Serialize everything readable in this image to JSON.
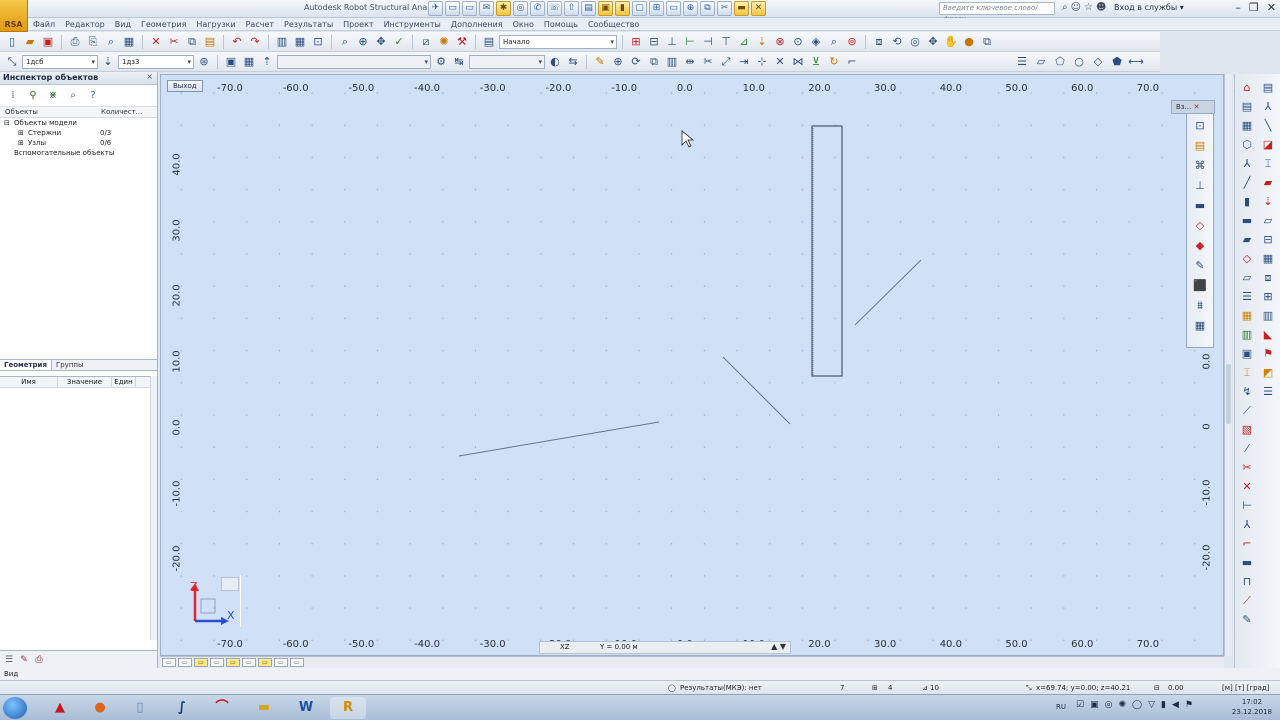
{
  "window": {
    "title": "Autodesk Robot Structural Analysis",
    "app_button_label": "RSA",
    "search_placeholder": "Введите ключевое слово/фразу",
    "signin_label": "Вход в службы"
  },
  "menu": [
    "Файл",
    "Редактор",
    "Вид",
    "Геометрия",
    "Нагрузки",
    "Расчет",
    "Результаты",
    "Проект",
    "Инструменты",
    "Дополнения",
    "Окно",
    "Помощь",
    "Сообщество"
  ],
  "toolbar1": {
    "view_combo": "Начало"
  },
  "toolbar2": {
    "combo1": "1дсб",
    "combo2": "1дз3"
  },
  "inspector": {
    "title": "Инспектор объектов",
    "col_objects": "Объекты",
    "col_count": "Количест...",
    "tree": [
      {
        "label": "Объекты модели",
        "count": "",
        "indent": 0,
        "toggle": "⊟"
      },
      {
        "label": "Стержни",
        "count": "0/3",
        "indent": 1,
        "toggle": "⊞"
      },
      {
        "label": "Узлы",
        "count": "0/6",
        "indent": 1,
        "toggle": "⊞"
      },
      {
        "label": "Вспомогательные объекты",
        "count": "",
        "indent": 0,
        "toggle": ""
      }
    ],
    "tabs": [
      "Геометрия",
      "Группы"
    ],
    "props_cols": [
      "Имя",
      "Значение",
      "Един"
    ]
  },
  "viewport": {
    "exit_label": "Выход",
    "x_ticks": [
      "-70.0",
      "-60.0",
      "-50.0",
      "-40.0",
      "-30.0",
      "-20.0",
      "-10.0",
      "0.0",
      "10.0",
      "20.0",
      "30.0",
      "40.0",
      "50.0",
      "60.0",
      "70.0"
    ],
    "y_ticks": [
      "40.0",
      "30.0",
      "20.0",
      "10.0",
      "0.0",
      "-10.0",
      "-20.0"
    ],
    "right_y_ticks": [
      "0.0",
      "0",
      "-10.0",
      "-20.0"
    ],
    "plane": "XZ",
    "plane_value": "Y = 0.00 м",
    "axis_z": "Z",
    "axis_x": "X",
    "float_panel_title": "Вз..."
  },
  "status": {
    "left": "Вид",
    "results": "Результаты(МКЭ): нет",
    "n1": "7",
    "n2": "4",
    "n3": "10",
    "coords": "x=69.74; y=0.00; z=40.21",
    "angle": "0.00",
    "units": "[м] [т] [град]"
  },
  "taskbar": {
    "lang": "RU",
    "time": "17:02",
    "date": "23.12.2018"
  }
}
